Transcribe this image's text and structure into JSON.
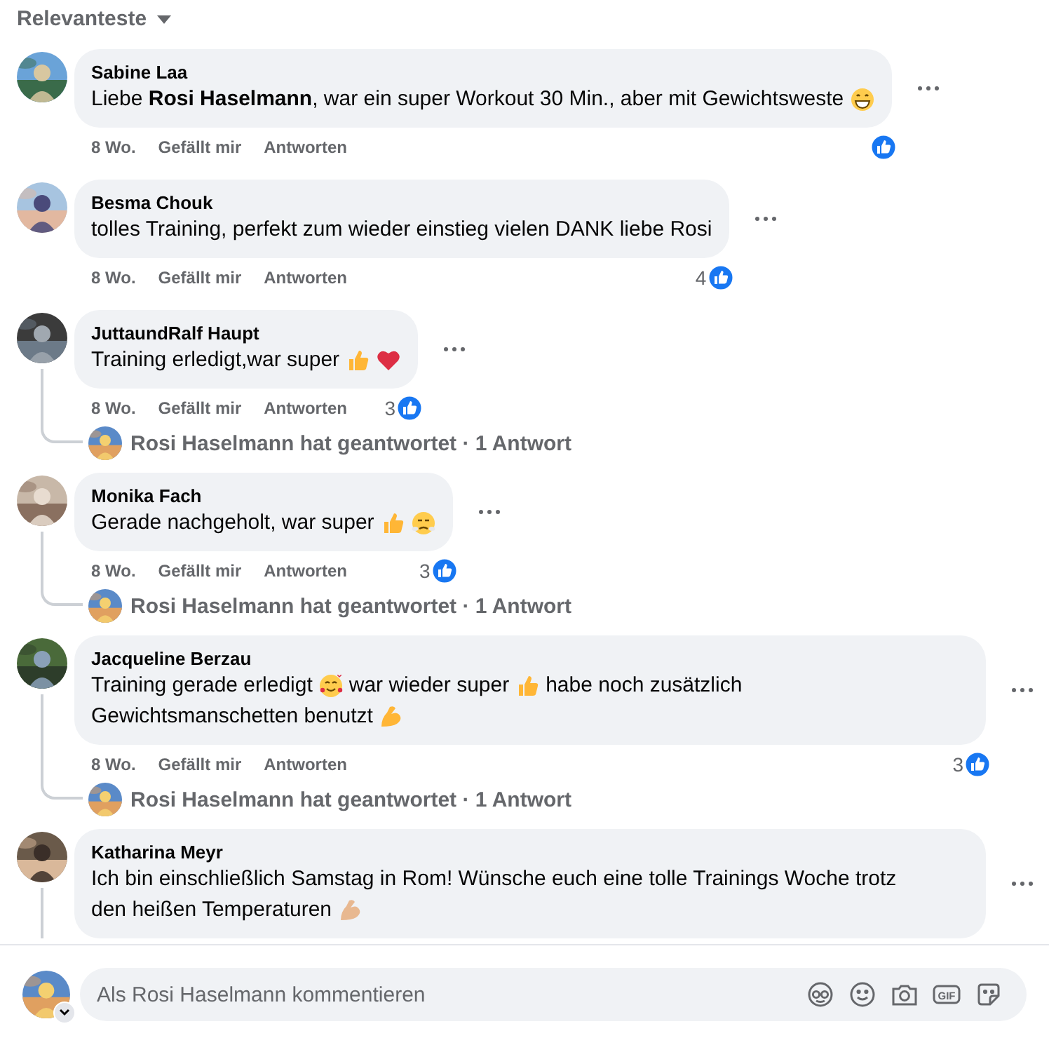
{
  "sort": {
    "label": "Relevanteste"
  },
  "comments": [
    {
      "author": "Sabine Laa",
      "parts": [
        {
          "kind": "text",
          "text": "Liebe **Rosi Haselmann**, war ein super Workout 30 Min., aber mit Gewichtsweste"
        },
        {
          "kind": "grin"
        }
      ],
      "time": "8 Wo.",
      "like_label": "Gefällt mir",
      "reply_label": "Antworten",
      "reacted": true
    },
    {
      "author": "Besma Chouk",
      "parts": [
        {
          "kind": "text",
          "text": "tolles Training, perfekt zum wieder einstieg vielen DANK liebe Rosi"
        }
      ],
      "time": "8 Wo.",
      "like_label": "Gefällt mir",
      "reply_label": "Antworten",
      "reacted": true,
      "reaction_count": "4"
    },
    {
      "author": "JuttaundRalf Haupt",
      "parts": [
        {
          "kind": "text",
          "text": "Training erledigt,war super"
        },
        {
          "kind": "thumbs"
        },
        {
          "kind": "heart"
        }
      ],
      "time": "8 Wo.",
      "like_label": "Gefällt mir",
      "reply_label": "Antworten",
      "reacted": true,
      "reaction_count": "3",
      "replies": {
        "text": "Rosi Haselmann hat geantwortet · 1 Antwort"
      }
    },
    {
      "author": "Monika Fach",
      "parts": [
        {
          "kind": "text",
          "text": "Gerade nachgeholt, war super"
        },
        {
          "kind": "thumbs"
        },
        {
          "kind": "steam"
        }
      ],
      "time": "8 Wo.",
      "like_label": "Gefällt mir",
      "reply_label": "Antworten",
      "reacted": true,
      "reaction_count": "3",
      "replies": {
        "text": "Rosi Haselmann hat geantwortet · 1 Antwort"
      }
    },
    {
      "author": "Jacqueline Berzau",
      "parts": [
        {
          "kind": "text",
          "text": "Training gerade erledigt"
        },
        {
          "kind": "hearts"
        },
        {
          "kind": "text",
          "text": "war wieder super"
        },
        {
          "kind": "thumbs"
        },
        {
          "kind": "text",
          "text": "habe noch zusätzlich"
        },
        {
          "kind": "text",
          "text": "Gewichtsmanschetten benutzt"
        },
        {
          "kind": "muscle"
        }
      ],
      "time": "8 Wo.",
      "like_label": "Gefällt mir",
      "reply_label": "Antworten",
      "reacted": true,
      "reaction_count": "3",
      "replies": {
        "text": "Rosi Haselmann hat geantwortet · 1 Antwort"
      }
    },
    {
      "author": "Katharina Meyr",
      "parts": [
        {
          "kind": "text",
          "text": "Ich bin einschließlich Samstag in Rom! Wünsche euch eine tolle Trainings Woche trotz"
        },
        {
          "kind": "text",
          "text": "den heißen Temperaturen"
        },
        {
          "kind": "muscle_light"
        }
      ],
      "thread_continues": true
    }
  ],
  "composer": {
    "placeholder": "Als Rosi Haselmann kommentieren",
    "gif_label": "GIF"
  }
}
